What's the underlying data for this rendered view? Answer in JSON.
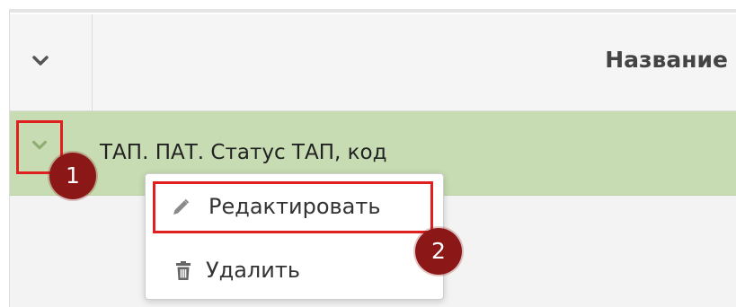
{
  "table": {
    "header": {
      "toggle_icon": "chevron-down-icon",
      "title": "Название"
    },
    "rows": [
      {
        "text": "ТАП. ПАТ. Статус ТАП, код",
        "selected": true,
        "toggle_icon": "chevron-down-icon"
      }
    ]
  },
  "context_menu": {
    "items": [
      {
        "label": "Редактировать",
        "icon": "pencil-icon"
      },
      {
        "label": "Удалить",
        "icon": "trash-icon"
      }
    ]
  },
  "callouts": [
    {
      "label": "1"
    },
    {
      "label": "2"
    }
  ],
  "colors": {
    "selected_row": "#c7dcb3",
    "highlight": "#e02020",
    "badge": "#8c1717"
  }
}
